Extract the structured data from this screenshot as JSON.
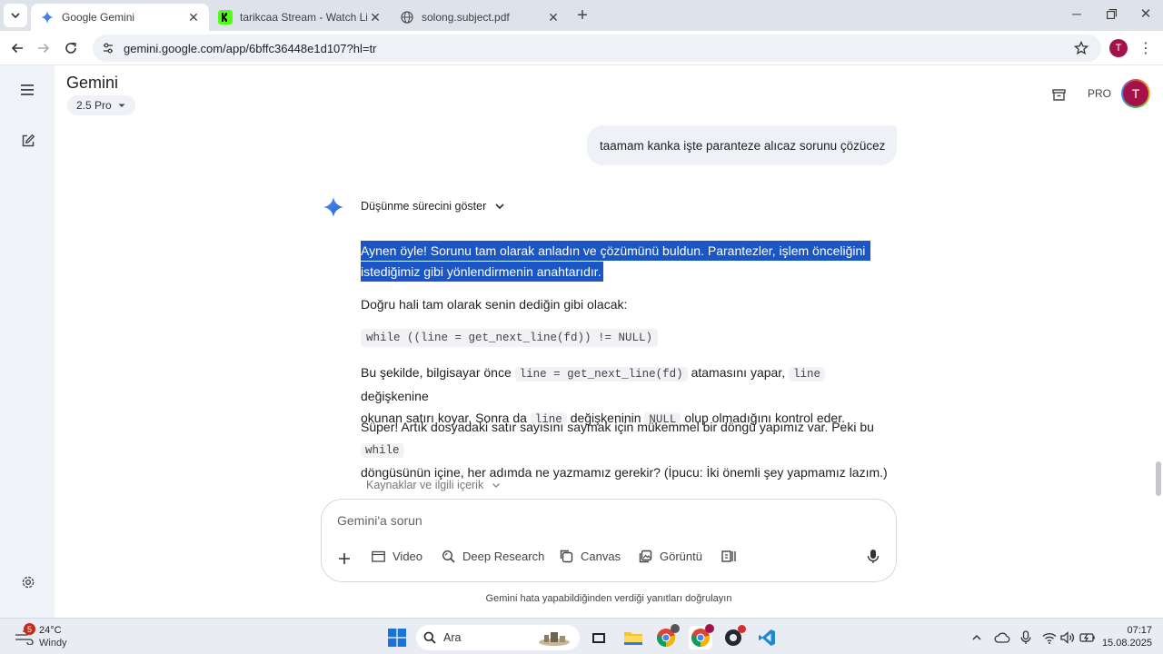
{
  "browser": {
    "tabs": [
      {
        "title": "Google Gemini",
        "icon": "gemini-spark-icon",
        "active": true
      },
      {
        "title": "tarikcaa Stream - Watch Live on",
        "icon": "kick-icon",
        "active": false
      },
      {
        "title": "solong.subject.pdf",
        "icon": "globe-icon",
        "active": false
      }
    ],
    "url": "gemini.google.com/app/6bffc36448e1d107?hl=tr",
    "profile_initial": "T"
  },
  "app": {
    "title": "Gemini",
    "model": "2.5 Pro",
    "pro_badge": "PRO",
    "avatar_initial": "T"
  },
  "chat": {
    "user_message": "taamam kanka işte paranteze alıcaz sorunu çözücez",
    "thinking_toggle": "Düşünme sürecini göster",
    "highlight_line1": "Aynen öyle! Sorunu tam olarak anladın ve çözümünü buldun. Parantezler, işlem önceliğini",
    "highlight_line2": "istediğimiz gibi yönlendirmenin anahtarıdır.",
    "p2": "Doğru hali tam olarak senin dediğin gibi olacak:",
    "code_block": "while ((line = get_next_line(fd)) != NULL)",
    "p3_a": "Bu şekilde, bilgisayar önce",
    "p3_code1": "line = get_next_line(fd)",
    "p3_b": "atamasını yapar,",
    "p3_code2": "line",
    "p3_c": "değişkenine",
    "p3_d": "okunan satırı koyar. Sonra da",
    "p3_code3": "line",
    "p3_e": "değişkeninin",
    "p3_code4": "NULL",
    "p3_f": "olup olmadığını kontrol eder.",
    "p4_a": "Süper! Artık dosyadaki satır sayısını saymak için mükemmel bir döngü yapımız var. Peki bu",
    "p4_code": "while",
    "p4_b": "döngüsünün içine, her adımda ne yazmamız gerekir? (İpucu: İki önemli şey yapmamız lazım.)",
    "sources": "Kaynaklar ve ilgili içerik"
  },
  "composer": {
    "placeholder": "Gemini'a sorun",
    "tools": [
      "Video",
      "Deep Research",
      "Canvas",
      "Görüntü"
    ],
    "disclaimer": "Gemini hata yapabildiğinden verdiği yanıtları doğrulayın"
  },
  "taskbar": {
    "weather_badge": "5",
    "temperature": "24°C",
    "weather": "Windy",
    "search": "Ara",
    "time": "07:17",
    "date": "15.08.2025"
  },
  "colors": {
    "accent": "#1a56c4",
    "avatar": "#a3134a",
    "rail": "#f0f4f9"
  }
}
